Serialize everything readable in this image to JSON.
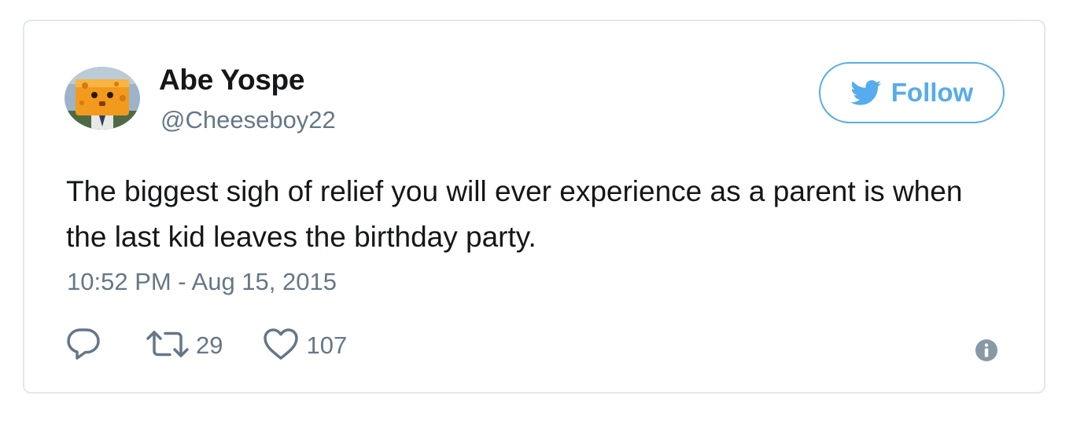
{
  "tweet": {
    "author_name": "Abe Yospe",
    "author_handle": "@Cheeseboy22",
    "avatar_icon": "cheese-avatar",
    "follow_label": "Follow",
    "follow_icon": "twitter-bird-icon",
    "text": "The biggest sigh of relief you will ever experience as a parent is when the last kid leaves the birthday party.",
    "timestamp": "10:52 PM - Aug 15, 2015",
    "actions": {
      "reply_icon": "reply-icon",
      "retweet_icon": "retweet-icon",
      "retweet_count": "29",
      "like_icon": "heart-icon",
      "like_count": "107"
    },
    "info_icon": "info-icon"
  },
  "colors": {
    "twitter_blue": "#55acee",
    "text_primary": "#14171a",
    "text_secondary": "#657786",
    "border": "#e1e8ed"
  }
}
